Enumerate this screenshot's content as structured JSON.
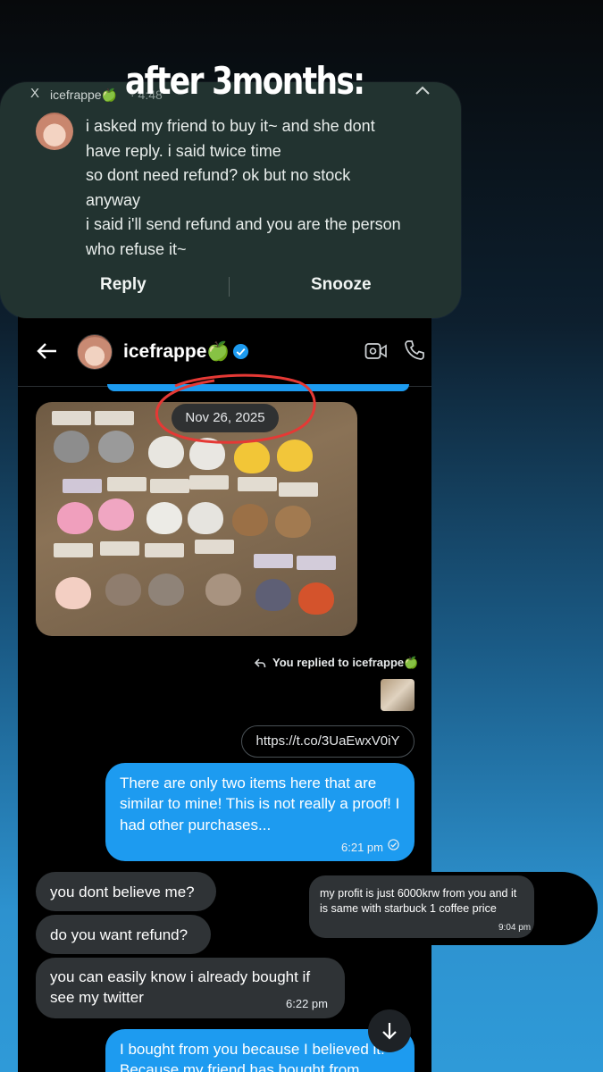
{
  "story": {
    "caption": "after 3months:"
  },
  "notification": {
    "close": "X",
    "app_name": "icefrappe🍏",
    "time": "· 4:48",
    "message_lines": [
      "i asked my friend to buy it~ and she dont",
      "have reply. i said twice time",
      "so dont need refund? ok but no stock",
      "anyway",
      "i said i'll send refund and you are the person",
      "who refuse it~"
    ],
    "actions": {
      "reply": "Reply",
      "snooze": "Snooze"
    }
  },
  "chat": {
    "header": {
      "name": "icefrappe🍏"
    },
    "photo_date": "Nov 26, 2025",
    "replied_to": "You replied to icefrappe🍏",
    "link": "https://t.co/3UaEwxV0iY",
    "messages": [
      {
        "text": "There are only two items here that are similar to mine! This is not really a proof! I had other purchases...",
        "time": "6:21 pm"
      },
      {
        "text": "you dont believe me?"
      },
      {
        "text": "do you want refund?"
      },
      {
        "text": "you can easily know i already bought if see my twitter",
        "time": "6:22 pm"
      },
      {
        "text": "I bought from you because I believed it! Because my friend has bought from"
      }
    ]
  },
  "overlay_note": {
    "text": "my profit is just 6000krw from you and it is same with starbuck 1 coffee price",
    "time": "9:04 pm"
  },
  "colors": {
    "accent": "#1d9bf0",
    "incoming_bubble": "#2f3336",
    "annotation": "#e53935"
  }
}
